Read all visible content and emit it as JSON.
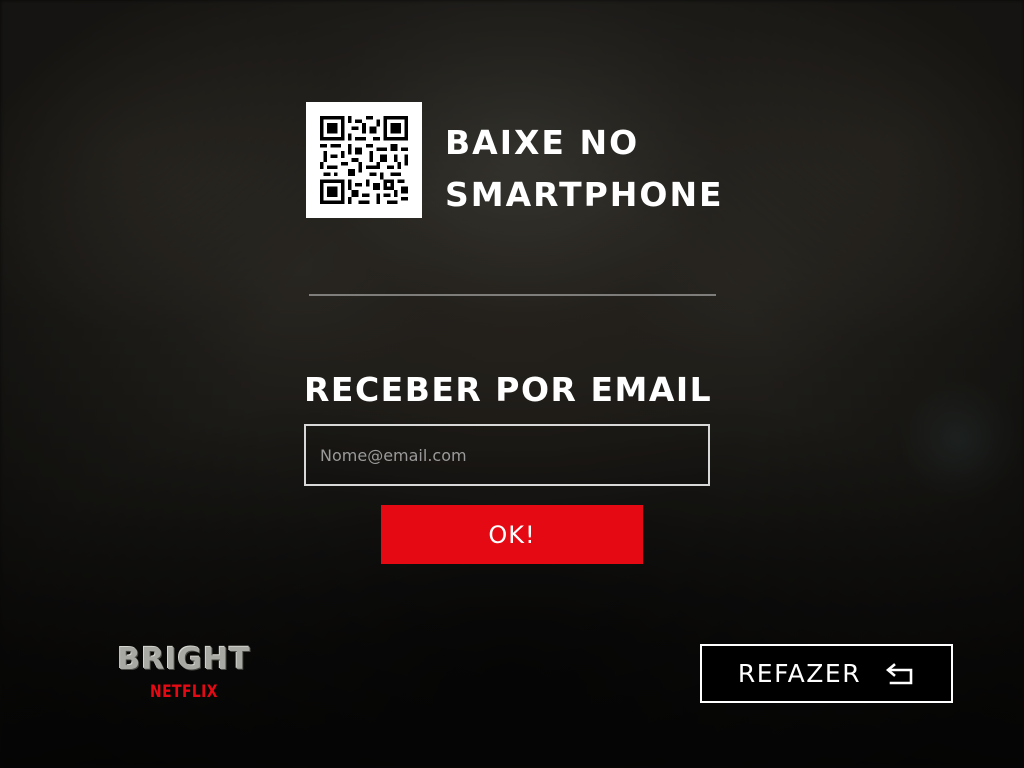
{
  "background": {
    "description_colors": {
      "accent": "#e50914",
      "text": "#ffffff",
      "input_border": "#d8d8d8",
      "placeholder": "#9a9a9a"
    }
  },
  "qr_section": {
    "title_line1": "BAIXE NO",
    "title_line2": "SMARTPHONE",
    "qr_icon": "qr-code-icon"
  },
  "email_section": {
    "title": "RECEBER POR EMAIL",
    "input_placeholder": "Nome@email.com",
    "input_value": "",
    "submit_label": "OK!"
  },
  "logo": {
    "title": "BRIGHT",
    "subtitle": "NETFLIX"
  },
  "redo": {
    "label": "REFAZER",
    "icon": "undo-arrow-icon"
  }
}
